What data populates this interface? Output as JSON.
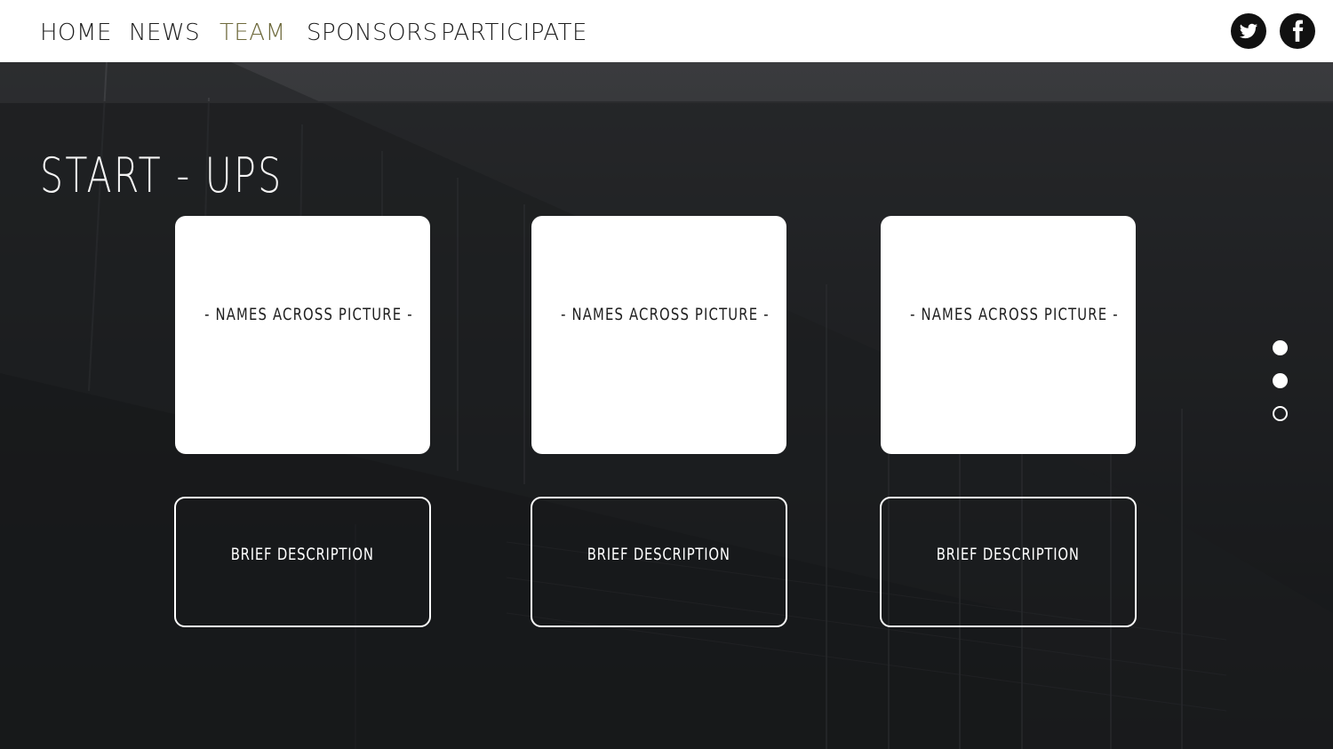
{
  "nav": {
    "items": [
      {
        "label": "HOME",
        "active": false
      },
      {
        "label": "NEWS",
        "active": false
      },
      {
        "label": "TEAM",
        "active": true
      },
      {
        "label": "SPONSORS",
        "active": false
      },
      {
        "label": "PARTICIPATE",
        "active": false
      }
    ],
    "active_color": "#6e6a3c"
  },
  "social": {
    "icons": [
      "twitter-icon",
      "facebook-icon"
    ]
  },
  "section": {
    "title": "START - UPS"
  },
  "cards": [
    {
      "label": "-  NAMES ACROSS PICTURE  -",
      "description": "BRIEF DESCRIPTION"
    },
    {
      "label": "-  NAMES ACROSS PICTURE  -",
      "description": "BRIEF DESCRIPTION"
    },
    {
      "label": "-  NAMES ACROSS PICTURE  -",
      "description": "BRIEF DESCRIPTION"
    }
  ],
  "pagination": {
    "dots": [
      {
        "state": "filled"
      },
      {
        "state": "filled"
      },
      {
        "state": "outline"
      }
    ]
  }
}
